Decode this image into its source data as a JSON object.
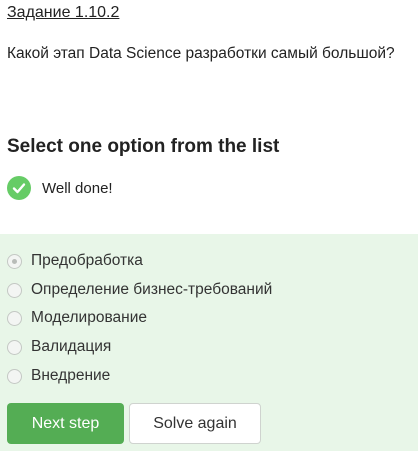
{
  "task": {
    "title": "Задание 1.10.2"
  },
  "question": {
    "text": "Какой этап Data Science разработки самый большой?"
  },
  "answer_section": {
    "heading": "Select one option from the list",
    "feedback": {
      "text": "Well done!",
      "icon": "check-circle-icon",
      "color": "#66cc66"
    },
    "panel_color": "#e8f6e8",
    "options": [
      {
        "label": "Предобработка",
        "selected": true
      },
      {
        "label": "Определение бизнес-требований",
        "selected": false
      },
      {
        "label": "Моделирование",
        "selected": false
      },
      {
        "label": "Валидация",
        "selected": false
      },
      {
        "label": "Внедрение",
        "selected": false
      }
    ]
  },
  "actions": {
    "next_label": "Next step",
    "next_color": "#54ad54",
    "solve_again_label": "Solve again"
  }
}
